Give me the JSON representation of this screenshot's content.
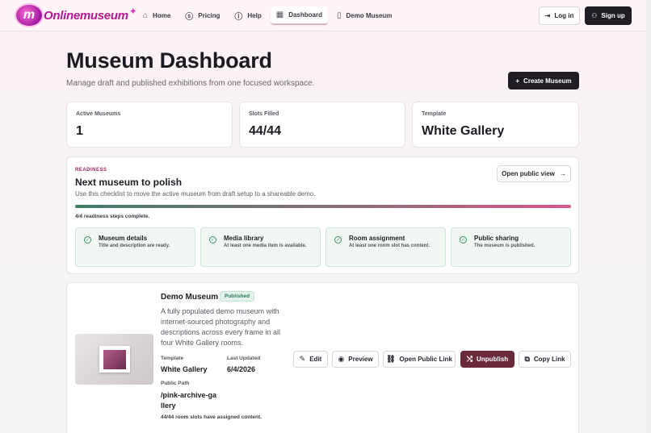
{
  "nav": {
    "logo_mark": "m",
    "logo_text": "Onlinemuseum",
    "links": [
      {
        "label": "Home",
        "icon": "home-icon",
        "glyph": "⌂"
      },
      {
        "label": "Pricing",
        "icon": "dollar-circle-icon",
        "glyph": "$"
      },
      {
        "label": "Help",
        "icon": "help-circle-icon",
        "glyph": "?"
      },
      {
        "label": "Dashboard",
        "icon": "grid-icon",
        "glyph": "▦",
        "active": true
      },
      {
        "label": "Demo Museum",
        "icon": "book-icon",
        "glyph": "▯"
      }
    ],
    "login_label": "Log in",
    "signup_label": "Sign up"
  },
  "header": {
    "title": "Museum Dashboard",
    "subtitle": "Manage draft and published exhibitions from one focused workspace.",
    "create_label": "Create Museum"
  },
  "stats": [
    {
      "label": "Active Museums",
      "value": "1"
    },
    {
      "label": "Slots Filled",
      "value": "44/44"
    },
    {
      "label": "Template",
      "value": "White Gallery"
    }
  ],
  "readiness": {
    "eyebrow": "READINESS",
    "title": "Next museum to polish",
    "description": "Use this checklist to move the active museum from draft setup to a shareable demo.",
    "open_public_label": "Open public view",
    "progress_fraction": 1.0,
    "progress_text": "4/4 readiness steps complete.",
    "steps": [
      {
        "title": "Museum details",
        "desc": "Title and description are ready."
      },
      {
        "title": "Media library",
        "desc": "At least one media item is available."
      },
      {
        "title": "Room assignment",
        "desc": "At least one room slot has content."
      },
      {
        "title": "Public sharing",
        "desc": "The museum is published."
      }
    ]
  },
  "museum": {
    "name": "Demo Museum",
    "status": "Published",
    "description": "A fully populated demo museum with internet-sourced photography and descriptions across every frame in all four White Gallery rooms.",
    "template_label": "Template",
    "template_value": "White Gallery",
    "updated_label": "Last Updated",
    "updated_value": "6/4/2026",
    "path_label": "Public Path",
    "path_value": "/pink-archive-gallery",
    "slots_note": "44/44 room slots have assigned content.",
    "actions": {
      "edit": "Edit",
      "preview": "Preview",
      "open_link": "Open Public Link",
      "unpublish": "Unpublish",
      "copy_link": "Copy Link"
    }
  },
  "colors": {
    "accent_dark": "#1f1c24",
    "unpublish": "#6a2a3c",
    "eyebrow": "#a4265f",
    "success": "#3a8f64",
    "brand": "#b4178f"
  }
}
